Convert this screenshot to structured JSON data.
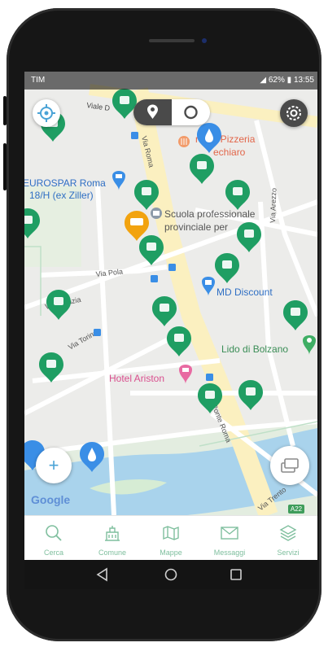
{
  "status_bar": {
    "carrier": "TIM",
    "battery": "62%",
    "time": "13:55"
  },
  "map": {
    "streets": [
      {
        "id": "viale-druso",
        "label": "Viale D"
      },
      {
        "id": "via-roma",
        "label": "Via Roma"
      },
      {
        "id": "via-pola",
        "label": "Via Pola"
      },
      {
        "id": "via-amazia",
        "label": "Via Amazia"
      },
      {
        "id": "via-torino",
        "label": "Via Torino"
      },
      {
        "id": "via-arezzo",
        "label": "Via Arezzo"
      },
      {
        "id": "ponte-roma",
        "label": "Ponte Roma"
      },
      {
        "id": "via-trento",
        "label": "Via Trento"
      }
    ],
    "places": {
      "pizzeria_line1": "rante Pizzeria",
      "pizzeria_line2": "echiaro",
      "eurospar_line1": "EUROSPAR Roma",
      "eurospar_line2": "18/H (ex Ziller)",
      "scuola_line1": "Scuola professionale",
      "scuola_line2": "provinciale per",
      "md_discount": "MD Discount",
      "lido": "Lido di Bolzano",
      "hotel": "Hotel Ariston"
    },
    "road_badge": "A22",
    "google_logo": "Google"
  },
  "controls": {
    "locate": "crosshair-icon",
    "settings": "gear-icon",
    "zoom_in": "+",
    "layers": "layers-icon"
  },
  "tabs": [
    {
      "label": "Cerca",
      "icon": "search-icon"
    },
    {
      "label": "Comune",
      "icon": "city-hall-icon"
    },
    {
      "label": "Mappe",
      "icon": "map-icon"
    },
    {
      "label": "Messaggi",
      "icon": "envelope-icon"
    },
    {
      "label": "Servizi",
      "icon": "services-layers-icon"
    }
  ],
  "colors": {
    "marker_green": "#1f9e63",
    "marker_orange": "#f2a30f",
    "marker_blue": "#3a8ee6",
    "tab_text": "#7fbf9e",
    "poi_red": "#d9534f",
    "road_yellow": "#fbf0c0"
  }
}
